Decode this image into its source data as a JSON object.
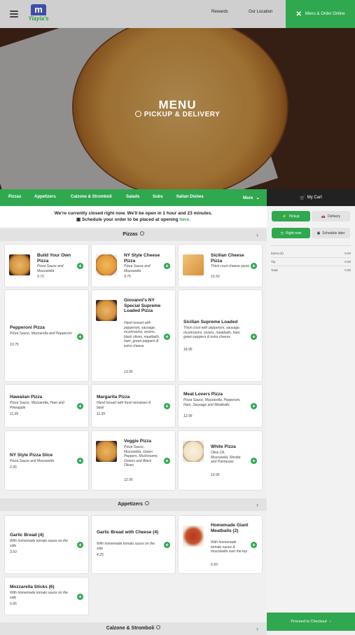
{
  "header": {
    "logo_text": "Yiayia's",
    "nav": [
      "Rewards",
      "Our Location"
    ],
    "order_button": "Menu & Order Online"
  },
  "hero": {
    "title": "MENU",
    "subtitle": "PICKUP & DELIVERY"
  },
  "categories": [
    "Pizzas",
    "Appetizers",
    "Calzone & Stromboli",
    "Salads",
    "Subs",
    "Italian Dishes",
    "More"
  ],
  "cart": {
    "label": "My Cart"
  },
  "notice": {
    "line1": "We're currently closed right now. We'll be open in 1 hour and 23 minutes.",
    "line2_prefix": "Schedule your order to be placed at opening",
    "line2_link": "here."
  },
  "sections": {
    "pizzas": {
      "title": "Pizzas",
      "items": [
        {
          "name": "Build Your Own Pizza",
          "desc": "Pizza Sauce and Mozzarella",
          "price": "9.75"
        },
        {
          "name": "NY Style Cheese Pizza",
          "desc": "Pizza Sauce and Mozzarella",
          "price": "9.75"
        },
        {
          "name": "Sicilian Cheese Pizza",
          "desc": "Thick crust cheese pizza",
          "price": "15.50"
        },
        {
          "name": "Pepperoni Pizza",
          "desc": "Pizza Sauce, Mozzarella and Pepperoni",
          "price": "10.75"
        },
        {
          "name": "Giovanni's NY Special Supreme Loaded Pizza",
          "desc": "Hand tossed with pepperoni, sausage, mushrooms, onions, black olives, meatballs, ham, green peppers & extra cheese",
          "price": "13.95"
        },
        {
          "name": "Sicilian Supreme Loaded",
          "desc": "Thick crust with pepperoni, sausage, mushrooms, onions, meatballs, ham, green peppers & extra cheese",
          "price": "18.95"
        },
        {
          "name": "Hawaiian Pizza",
          "desc": "Pizza Sauce, Mozzarella, Ham and Pineapple",
          "price": "11.95"
        },
        {
          "name": "Margarita Pizza",
          "desc": "Hand tossed with fresh tomatoes & basil",
          "price": "11.95"
        },
        {
          "name": "Meat Lovers Pizza",
          "desc": "Pizza Sauce, Mozzarella, Pepperoni, Ham, Sausage and Meatballs",
          "price": "12.95"
        },
        {
          "name": "NY Style Pizza Slice",
          "desc": "Pizza Sauce and Mozzarella",
          "price": "2.95"
        },
        {
          "name": "Veggie Pizza",
          "desc": "Pizza Sauce, Mozzarella, Green Peppers, Mushrooms, Onions and Black Olives",
          "price": "12.95"
        },
        {
          "name": "White Pizza",
          "desc": "Olive Oil, Mozzarella, Ricotta and Parmesan",
          "price": "10.95"
        }
      ]
    },
    "appetizers": {
      "title": "Appetizers",
      "items": [
        {
          "name": "Garlic Bread (4)",
          "desc": "With homemade tomato sauce on the side",
          "price": "3.50"
        },
        {
          "name": "Garlic Bread with Cheese (4)",
          "desc": "With homemade tomato sauce on the side",
          "price": "4.25"
        },
        {
          "name": "Homemade Giant Meatballs (2)",
          "desc": "With homemade tomato sauce & mozzarella over the top",
          "price": "6.50"
        },
        {
          "name": "Mozzarella Sticks (6)",
          "desc": "With homemade tomato sauce on the side",
          "price": "5.95"
        }
      ]
    },
    "calzone": {
      "title": "Calzone & Stromboli"
    }
  },
  "panel": {
    "pickup": "Pickup",
    "delivery": "Delivery",
    "right_now": "Right now",
    "schedule_later": "Schedule later",
    "rows": [
      {
        "label": "Items (0)",
        "value": "0.00"
      },
      {
        "label": "Tip",
        "value": "0.00"
      },
      {
        "label": "Total",
        "value": "0.00"
      }
    ],
    "checkout": "Proceed to Checkout"
  },
  "colors": {
    "brand_green": "#2fa84f",
    "dark": "#222222"
  }
}
